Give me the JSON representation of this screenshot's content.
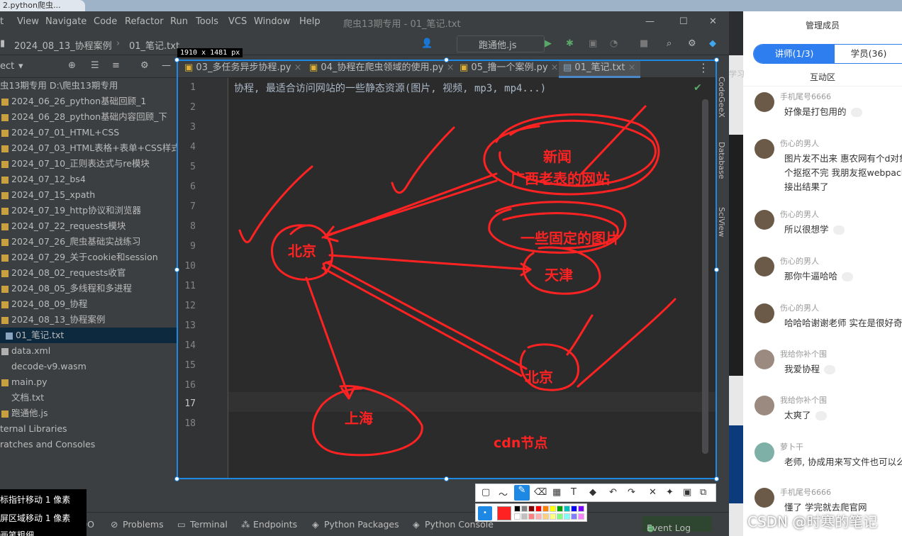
{
  "window": {
    "top_tab": "2.python爬虫..."
  },
  "menu": {
    "items": [
      "t",
      "View",
      "Navigate",
      "Code",
      "Refactor",
      "Run",
      "Tools",
      "VCS",
      "Window",
      "Help"
    ],
    "title": "爬虫13期专用 - 01_笔记.txt"
  },
  "nav": {
    "breadcrumb_1": "2024_08_13_协程案例",
    "breadcrumb_2": "01_笔记.txt",
    "run_config": "跑通他.js"
  },
  "project": {
    "label": "ect"
  },
  "sidebar": {
    "root": "虫13期专用  D:\\爬虫13期专用",
    "items": [
      "2024_06_26_python基础回顾_1",
      "2024_06_28_python基础内容回顾_下",
      "2024_07_01_HTML+CSS",
      "2024_07_03_HTML表格+表单+CSS样式",
      "2024_07_10_正则表达式与re模块",
      "2024_07_12_bs4",
      "2024_07_15_xpath",
      "2024_07_19_http协议和浏览器",
      "2024_07_22_requests模块",
      "2024_07_26_爬虫基础实战练习",
      "2024_07_29_关于cookie和session",
      "2024_08_02_requests收官",
      "2024_08_05_多线程和多进程",
      "2024_08_09_协程",
      "2024_08_13_协程案例",
      "01_笔记.txt",
      "data.xml",
      "decode-v9.wasm",
      "main.py",
      "文档.txt",
      "跑通他.js",
      "ternal Libraries",
      "ratches and Consoles"
    ]
  },
  "tabs": [
    "03_多任务异步协程.py",
    "04_协程在爬虫领域的使用.py",
    "05_撸一个案例.py",
    "01_笔记.txt"
  ],
  "editor": {
    "line_numbers": [
      "1",
      "2",
      "3",
      "4",
      "5",
      "6",
      "7",
      "8",
      "9",
      "10",
      "11",
      "12",
      "13",
      "14",
      "15",
      "16",
      "17",
      "18"
    ],
    "line1": "协程, 最适合访问网站的一些静态资源(图片, 视频, mp3, mp4...)"
  },
  "right_tools": [
    "CodeGeeX",
    "Database",
    "SciView"
  ],
  "bottom": {
    "items": [
      "TODO",
      "Problems",
      "Terminal",
      "Endpoints",
      "Python Packages",
      "Python Console"
    ],
    "event_log": "Event Log"
  },
  "tooltip": {
    "lines": [
      "标指针移动 1 像素",
      "屏区域移动 1 像素",
      "画笔粗细"
    ]
  },
  "snip": {
    "dimensions": "1910 x 1481  px",
    "tools": [
      "rect-icon",
      "line-icon",
      "pen-icon",
      "marker-icon",
      "mosaic-icon",
      "text-icon",
      "eraser-icon",
      "undo-icon",
      "redo-icon",
      "close-icon",
      "pin-icon",
      "save-icon",
      "copy-icon"
    ],
    "palette": [
      "#000000",
      "#808080",
      "#800000",
      "#ff0000",
      "#ff8000",
      "#ffff00",
      "#00a000",
      "#00c0c0",
      "#0000ff",
      "#8000ff",
      "#ffffff",
      "#c0c0c0",
      "#ff8080",
      "#ffb0b0",
      "#ffd080",
      "#ffff80",
      "#80ff80",
      "#80ffff",
      "#8080ff",
      "#ff80ff"
    ]
  },
  "annotations": {
    "beijing1": "北京",
    "news": "新闻",
    "guangxi": "广西老表的网站",
    "images": "一些固定的图片",
    "tianjin": "天津",
    "beijing2": "北京",
    "shanghai": "上海",
    "cdn": "cdn节点"
  },
  "chat": {
    "header": "管理成员",
    "tab_teacher": "讲师(1/3)",
    "tab_student": "学员(36)",
    "section": "互动区",
    "side_peek": "学习",
    "messages": [
      {
        "name": "手机尾号6666",
        "text": "好像是打包用的"
      },
      {
        "name": "伤心的男人",
        "text": "图片发不出来 惠农网有个d对象",
        "text2": "个抠抠不完 我朋友抠webpack",
        "text3": "接出结果了"
      },
      {
        "name": "伤心的男人",
        "text": "所以很想学"
      },
      {
        "name": "伤心的男人",
        "text": "那你牛逼哈哈"
      },
      {
        "name": "伤心的男人",
        "text": "哈哈哈谢谢老师 实在是很好奇"
      },
      {
        "name": "我给你补个围",
        "text": "我爱协程"
      },
      {
        "name": "我给你补个围",
        "text": "太爽了"
      },
      {
        "name": "萝卜干",
        "text": "老师, 协成用来写文件也可以么"
      },
      {
        "name": "手机尾号6666",
        "text": "懂了  学完就去爬官网"
      }
    ]
  },
  "watermark": "CSDN @时寒的笔记",
  "colors": {
    "ink": "#ff2222",
    "accent": "#2f7ef0",
    "selection": "#1e88e5"
  }
}
